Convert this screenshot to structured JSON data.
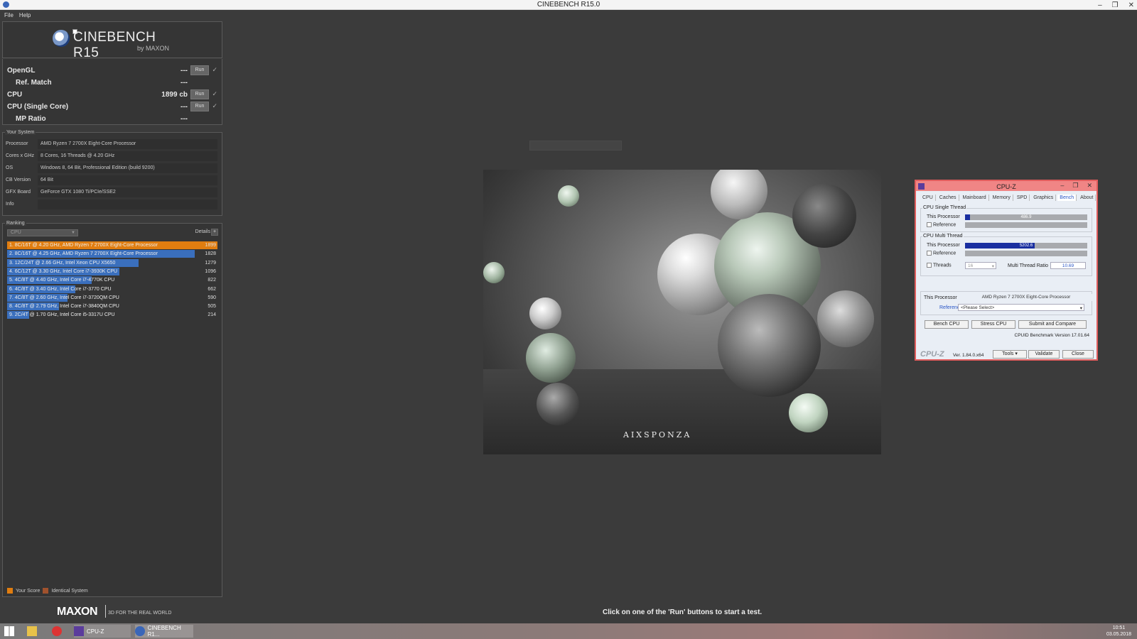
{
  "window": {
    "title": "CINEBENCH R15.0",
    "minimize": "–",
    "restore": "❐",
    "close": "✕"
  },
  "menu": [
    "File",
    "Help"
  ],
  "logo": {
    "brand": "CINEBENCH R15",
    "by": "by MAXON"
  },
  "tests": [
    {
      "name": "OpenGL",
      "score": "---",
      "run": "Run",
      "check": "✓",
      "sub": false
    },
    {
      "name": "Ref. Match",
      "score": "---",
      "sub": true
    },
    {
      "name": "CPU",
      "score": "1899 cb",
      "run": "Run",
      "check": "✓",
      "sub": false
    },
    {
      "name": "CPU (Single Core)",
      "score": "---",
      "run": "Run",
      "check": "✓",
      "sub": false
    },
    {
      "name": "MP Ratio",
      "score": "---",
      "sub": true
    }
  ],
  "your_system": {
    "title": "Your System",
    "rows": [
      {
        "key": "Processor",
        "value": "AMD Ryzen 7 2700X Eight-Core Processor"
      },
      {
        "key": "Cores x GHz",
        "value": "8 Cores, 16 Threads @ 4.20 GHz"
      },
      {
        "key": "OS",
        "value": "Windows 8, 64 Bit, Professional Edition (build 9200)"
      },
      {
        "key": "CB Version",
        "value": "64 Bit"
      },
      {
        "key": "GFX Board",
        "value": "GeForce GTX 1080 Ti/PCIe/SSE2"
      },
      {
        "key": "Info",
        "value": ""
      }
    ]
  },
  "ranking": {
    "title": "Ranking",
    "select": "CPU",
    "details": "Details",
    "details_btn": "+",
    "max": 1899,
    "rows": [
      {
        "label": "1. 8C/16T @ 4.20 GHz, AMD Ryzen 7 2700X Eight-Core Processor",
        "value": "1899",
        "score": 1899,
        "kind": "yours"
      },
      {
        "label": "2. 8C/16T @ 4.25 GHz, AMD Ryzen 7 2700X Eight-Core Processor",
        "value": "1828",
        "score": 1828,
        "kind": "other"
      },
      {
        "label": "3. 12C/24T @ 2.66 GHz, Intel Xeon CPU X5650",
        "value": "1279",
        "score": 1279,
        "kind": "other"
      },
      {
        "label": "4. 6C/12T @ 3.30 GHz,  Intel Core i7-3930K CPU",
        "value": "1096",
        "score": 1096,
        "kind": "other"
      },
      {
        "label": "5. 4C/8T @ 4.40 GHz, Intel Core i7-4770K CPU",
        "value": "822",
        "score": 822,
        "kind": "other"
      },
      {
        "label": "6. 4C/8T @ 3.40 GHz,  Intel Core i7-3770 CPU",
        "value": "662",
        "score": 662,
        "kind": "other"
      },
      {
        "label": "7. 4C/8T @ 2.60 GHz, Intel Core i7-3720QM CPU",
        "value": "590",
        "score": 590,
        "kind": "other"
      },
      {
        "label": "8. 4C/8T @ 2.79 GHz,  Intel Core i7-3840QM CPU",
        "value": "505",
        "score": 505,
        "kind": "other"
      },
      {
        "label": "9. 2C/4T @ 1.70 GHz,  Intel Core i5-3317U CPU",
        "value": "214",
        "score": 214,
        "kind": "other"
      }
    ],
    "legend": {
      "yours": "Your Score",
      "identical": "Identical System"
    }
  },
  "colors": {
    "your_score": "#e07d10",
    "other": "#3a6fbd",
    "identical": "#a0522d"
  },
  "footer": {
    "maxon": "MAXON",
    "tagline": "3D FOR THE REAL WORLD"
  },
  "render": {
    "watermark": "AIXSPONZA"
  },
  "status": "Click on one of the 'Run' buttons to start a test.",
  "cpuz": {
    "title": "CPU-Z",
    "tabs": [
      "CPU",
      "Caches",
      "Mainboard",
      "Memory",
      "SPD",
      "Graphics",
      "Bench",
      "About"
    ],
    "active_tab": "Bench",
    "single_title": "CPU Single Thread",
    "multi_title": "CPU Multi Thread",
    "this_processor": "This Processor",
    "reference": "Reference",
    "single_value": "486.9",
    "single_frac": 0.04,
    "multi_value": "5202.6",
    "multi_frac": 0.57,
    "threads_label": "Threads",
    "threads_value": "16",
    "ratio_label": "Multi Thread Ratio",
    "ratio_value": "10.69",
    "proc_label": "This Processor",
    "proc_value": "AMD Ryzen 7 2700X Eight-Core Processor",
    "ref_label": "Reference",
    "ref_value": "<Please Select>",
    "btn_bench": "Bench CPU",
    "btn_stress": "Stress CPU",
    "btn_submit": "Submit and Compare",
    "bench_version": "CPUID Benchmark Version 17.01.64",
    "logo": "CPU-Z",
    "version": "Ver. 1.84.0.x64",
    "tools": "Tools",
    "validate": "Validate",
    "close": "Close"
  },
  "taskbar": {
    "cpuz": "CPU-Z",
    "cinebench": "CINEBENCH R1...",
    "time": "10:51",
    "date": "03.05.2018"
  }
}
